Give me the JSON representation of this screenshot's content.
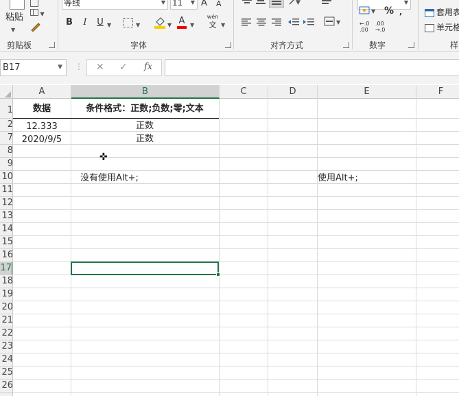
{
  "ribbon": {
    "clipboard": {
      "label": "剪贴板",
      "paste": "粘贴"
    },
    "font": {
      "label": "字体",
      "name": "等线",
      "size": "11",
      "bold": "B",
      "italic": "I",
      "underline": "U",
      "grow": "A",
      "shrink": "A",
      "font_color": "A",
      "pinyin_top": "wén",
      "pinyin_bottom": "文"
    },
    "alignment": {
      "label": "对齐方式"
    },
    "number": {
      "label": "数字",
      "percent": "%",
      "dec_inc": "←.0\n.00",
      "dec_dec": ".00\n→.0"
    },
    "styles": {
      "label": "样",
      "format_table": "套用表",
      "cell_styles": "单元格"
    }
  },
  "formula_bar": {
    "name_box": "B17",
    "cancel": "✕",
    "enter": "✓",
    "fx": "fx",
    "value": ""
  },
  "grid": {
    "columns": [
      "A",
      "B",
      "C",
      "D",
      "E",
      "F"
    ],
    "selected_column": "B",
    "rows": [
      "1",
      "2",
      "7",
      "8",
      "9",
      "10",
      "11",
      "12",
      "13",
      "14",
      "15",
      "16",
      "17",
      "18",
      "19",
      "20",
      "21",
      "22",
      "23",
      "24",
      "25",
      "26"
    ],
    "selected_row": "17",
    "cells": {
      "A1": "数据",
      "B1": "条件格式：正数;负数;零;文本",
      "A2": "12.333",
      "B2": "正数",
      "A7": "2020/9/5",
      "B7": "正数",
      "B10": "没有使用Alt+;",
      "E10": "使用Alt+;"
    }
  },
  "colors": {
    "accent": "#217346",
    "header_bg": "#f0f0f0",
    "ribbon_bg": "#f3f3f3"
  }
}
